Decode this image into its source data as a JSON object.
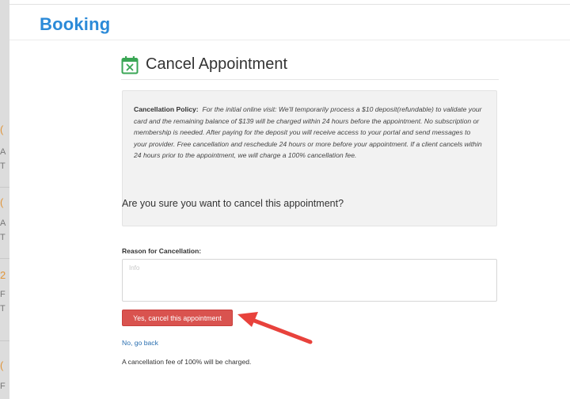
{
  "app": {
    "title": "Booking"
  },
  "left_strip": {
    "glyphs": [
      "(",
      "A",
      "T",
      "(",
      "A",
      "T",
      "2",
      "F",
      "T",
      "(",
      "F"
    ]
  },
  "modal": {
    "icon": "calendar-x-icon",
    "title": "Cancel Appointment",
    "policy": {
      "label": "Cancellation Policy:",
      "text": "For the initial online visit: We'll temporarily process a $10 deposit(refundable) to validate your card and the remaining balance of $139 will be charged within 24 hours before the appointment. No subscription or membership is needed. After paying for the deposit you will receive access to your portal and send messages to your provider. Free cancellation and reschedule 24 hours or more before your appointment. If a client cancels within 24 hours prior to the appointment, we will charge a 100% cancellation fee."
    },
    "question": "Are you sure you want to cancel this appointment?",
    "reason": {
      "label": "Reason for Cancellation:",
      "value": "",
      "placeholder": "Info"
    },
    "confirm_button": "Yes, cancel this appointment",
    "back_link": "No, go back",
    "fee_note": "A cancellation fee of 100% will be charged."
  },
  "colors": {
    "brand": "#2b8ad8",
    "danger": "#d9534f",
    "link": "#2a6fb0",
    "annotation_arrow": "#e8423c",
    "icon_green": "#3aa655"
  }
}
